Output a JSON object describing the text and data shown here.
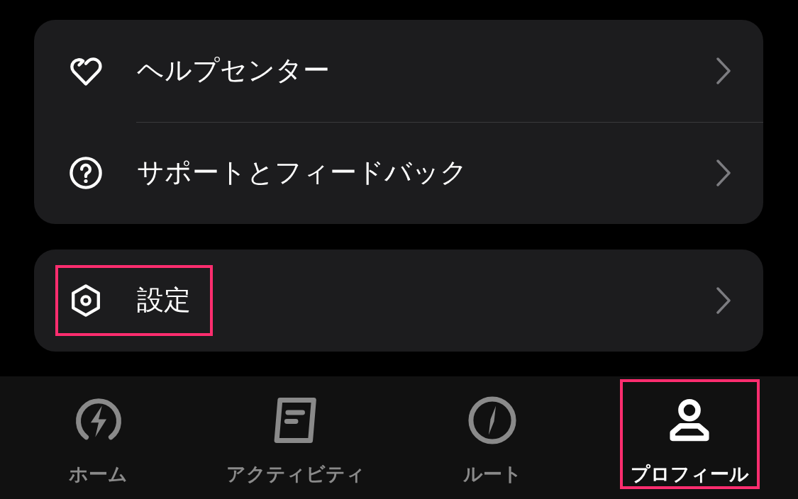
{
  "groups": [
    {
      "items": [
        {
          "kind": "help",
          "label": "ヘルプセンター",
          "highlighted": false
        },
        {
          "kind": "support",
          "label": "サポートとフィードバック",
          "highlighted": false
        }
      ]
    },
    {
      "items": [
        {
          "kind": "settings",
          "label": "設定",
          "highlighted": true
        }
      ]
    }
  ],
  "tab_bar": {
    "tabs": [
      {
        "kind": "home",
        "label": "ホーム",
        "selected": false,
        "highlighted": false
      },
      {
        "kind": "activity",
        "label": "アクティビティ",
        "selected": false,
        "highlighted": false
      },
      {
        "kind": "route",
        "label": "ルート",
        "selected": false,
        "highlighted": false
      },
      {
        "kind": "profile",
        "label": "プロフィール",
        "selected": true,
        "highlighted": true
      }
    ]
  }
}
